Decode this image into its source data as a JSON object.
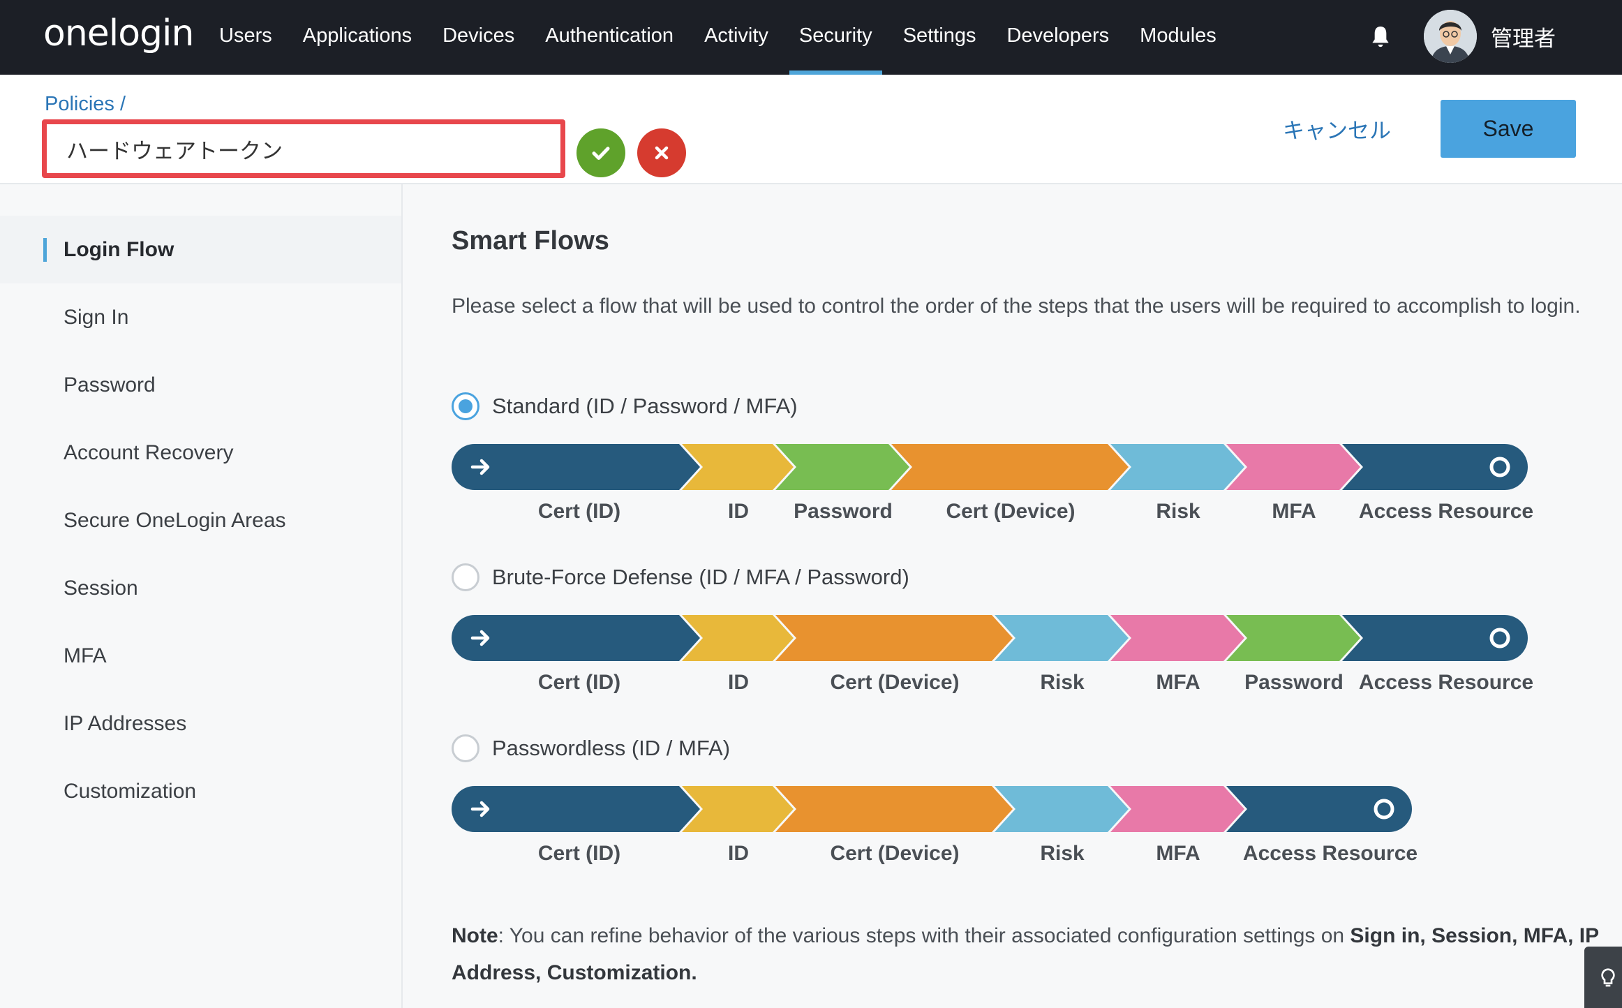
{
  "app": {
    "logo": "onelogin",
    "nav": [
      "Users",
      "Applications",
      "Devices",
      "Authentication",
      "Activity",
      "Security",
      "Settings",
      "Developers",
      "Modules"
    ],
    "active_nav": "Security",
    "user_name": "管理者"
  },
  "header": {
    "breadcrumb": "Policies /",
    "policy_name": "ハードウェアトークン",
    "cancel_label": "キャンセル",
    "save_label": "Save"
  },
  "sidebar": {
    "items": [
      "Login Flow",
      "Sign In",
      "Password",
      "Account Recovery",
      "Secure OneLogin Areas",
      "Session",
      "MFA",
      "IP Addresses",
      "Customization"
    ],
    "active": "Login Flow"
  },
  "main": {
    "title": "Smart Flows",
    "description": "Please select a flow that will be used to control the order of the steps that the users will be required to accomplish to login.",
    "flows": [
      {
        "label": "Standard (ID / Password / MFA)",
        "selected": true,
        "steps": [
          "Cert (ID)",
          "ID",
          "Password",
          "Cert (Device)",
          "Risk",
          "MFA",
          "Access Resource"
        ]
      },
      {
        "label": "Brute-Force Defense (ID / MFA / Password)",
        "selected": false,
        "steps": [
          "Cert (ID)",
          "ID",
          "Cert (Device)",
          "Risk",
          "MFA",
          "Password",
          "Access Resource"
        ]
      },
      {
        "label": "Passwordless (ID / MFA)",
        "selected": false,
        "steps": [
          "Cert (ID)",
          "ID",
          "Cert (Device)",
          "Risk",
          "MFA",
          "Access Resource"
        ]
      }
    ],
    "note": {
      "lead": "Note",
      "text": ": You can refine behavior of the various steps with their associated configuration settings on ",
      "links": "Sign in, Session, MFA, IP Address, Customization."
    }
  },
  "colors": {
    "Cert (ID)": "#265a7d",
    "ID": "#e8b83a",
    "Password": "#78bd52",
    "Cert (Device)": "#e8922f",
    "Risk": "#6fbbd8",
    "MFA": "#e879a8",
    "Access Resource": "#265a7d",
    "accent": "#4aa3df"
  },
  "icons": {
    "bell": "bell-icon",
    "confirm": "check-icon",
    "discard": "close-icon",
    "hint": "lightbulb-icon"
  }
}
